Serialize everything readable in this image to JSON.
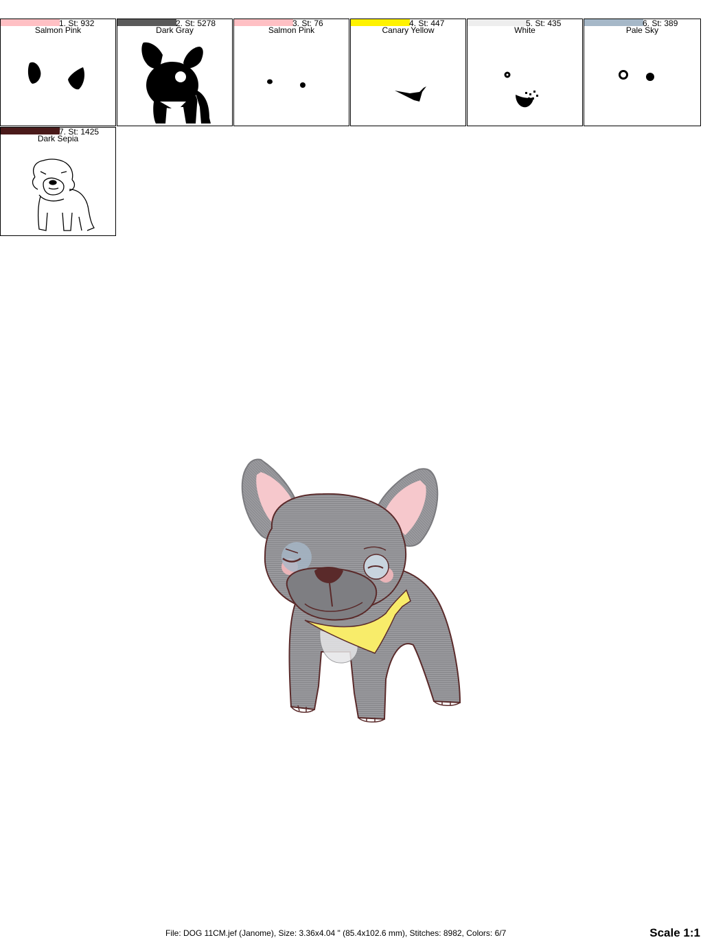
{
  "colors_list": [
    {
      "step": "1. St: 932",
      "name": "Salmon Pink",
      "swatch": "#ffc0c4"
    },
    {
      "step": "2. St: 5278",
      "name": "Dark Gray",
      "swatch": "#5a5a5a"
    },
    {
      "step": "3. St: 76",
      "name": "Salmon Pink",
      "swatch": "#ffc0c4"
    },
    {
      "step": "4. St: 447",
      "name": "Canary Yellow",
      "swatch": "#fff200"
    },
    {
      "step": "5. St: 435",
      "name": "White",
      "swatch": "#eeeeee"
    },
    {
      "step": "6. St: 389",
      "name": "Pale Sky",
      "swatch": "#a6b8c8"
    },
    {
      "step": "7. St: 1425",
      "name": "Dark Sepia",
      "swatch": "#4a1a1a"
    }
  ],
  "footer": {
    "file_info": "File: DOG 11CM.jef (Janome), Size: 3.36x4.04 \" (85.4x102.6 mm), Stitches: 8982, Colors: 6/7",
    "scale": "Scale 1:1"
  },
  "palette": {
    "dog_gray": "#8c8c90",
    "ear_pink": "#f6c8cc",
    "bandana_yellow": "#f8ec6a",
    "outline_sepia": "#5a2a2a"
  }
}
